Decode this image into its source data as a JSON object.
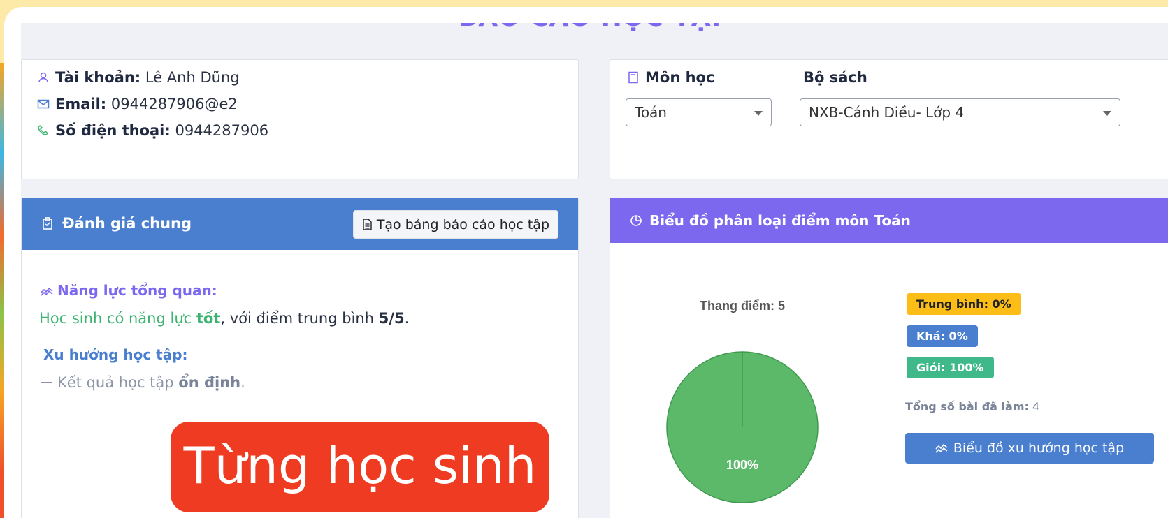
{
  "page": {
    "title": "BÁO CÁO HỌC TẬP"
  },
  "account": {
    "account_label": "Tài khoản:",
    "account_value": "Lê Anh Dũng",
    "email_label": "Email:",
    "email_value": "0944287906@e2",
    "phone_label": "Số điện thoại:",
    "phone_value": "0944287906"
  },
  "subject": {
    "subject_label": "Môn học",
    "subject_value": "Toán",
    "book_label": "Bộ sách",
    "book_value": "NXB-Cánh Diều- Lớp 4"
  },
  "evaluation": {
    "title": "Đánh giá chung",
    "report_button": "Tạo bảng báo cáo học tập",
    "ability_title": "Năng lực tổng quan:",
    "ability_prefix": "Học sinh có năng lực",
    "ability_level": "tốt",
    "ability_middle": ", với điểm trung bình",
    "ability_score": "5/5",
    "ability_end": ".",
    "trend_title": "Xu hướng học tập:",
    "trend_prefix": "Kết quả học tập",
    "trend_value": "ổn định",
    "trend_end": "."
  },
  "chart_panel": {
    "title": "Biểu đồ phân loại điểm môn Toán",
    "badge_average": "Trung bình: 0%",
    "badge_good": "Khá: 0%",
    "badge_excellent": "Giỏi: 100%",
    "total_label": "Tổng số bài đã làm:",
    "total_value": "4",
    "trend_button": "Biểu đồ xu hướng học tập"
  },
  "chart_data": {
    "type": "pie",
    "title": "Thang điểm: 5",
    "slices": [
      {
        "label": "Trung bình",
        "value": 0,
        "color": "#fbbd16"
      },
      {
        "label": "Khá",
        "value": 0,
        "color": "#4a7fd0"
      },
      {
        "label": "Giỏi",
        "value": 100,
        "color": "#5cb96a"
      }
    ],
    "data_labels": [
      "100%"
    ]
  },
  "overlay": {
    "text": "Từng học sinh"
  },
  "colors": {
    "primary_blue": "#4a7fd0",
    "purple": "#7b68ee",
    "green": "#3cb371",
    "overlay_red": "#ef3b21"
  }
}
